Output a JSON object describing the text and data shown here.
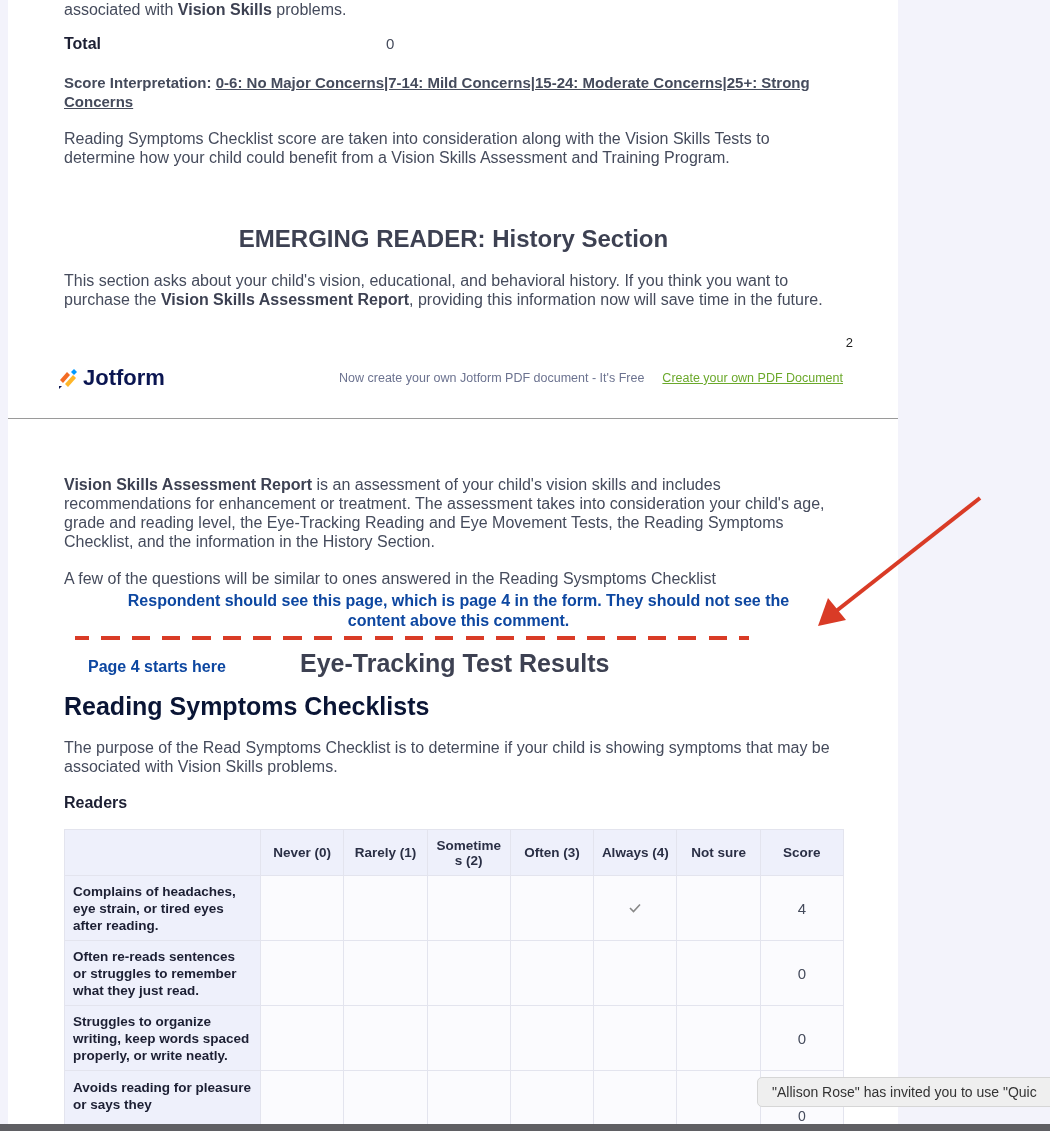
{
  "page_one": {
    "intro_tail": "associated with **Vision Skills** problems.",
    "total": {
      "label": "Total",
      "value": "0"
    },
    "score_interpretation": {
      "label": "Score Interpretation:",
      "value": "0-6: No Major Concerns|7-14: Mild Concerns|15-24: Moderate Concerns|25+:  Strong Concerns"
    },
    "note": " Reading Symptoms Checklist score are taken into consideration along with the Vision Skills Tests to determine how your child could benefit from a Vision Skills Assessment and Training Program.",
    "history": {
      "title": "EMERGING READER: History Section",
      "text": "This section asks about your child's vision, educational, and behavioral history. If you think you want to purchase the **Vision Skills Assessment Report**, providing this information now will save time in the future."
    },
    "page_number": "2"
  },
  "footer": {
    "brand": "Jotform",
    "tagline": "Now create your own Jotform PDF document - It's Free",
    "link": "Create your own PDF Document"
  },
  "page_two": {
    "report_text": "**Vision Skills Assessment Report** is an assessment of your child's vision skills and includes recommendations for enhancement or treatment.  The assessment takes into consideration your child's age, grade and reading level, the Eye-Tracking Reading and Eye Movement Tests, the Reading Symptoms Checklist, and the information in the History Section.",
    "similar_note": "A few of the questions will be similar to ones answered in the Reading Sysmptoms Checklist",
    "annotation": {
      "comment": "Respondent should see this page, which is page 4 in the form.  They should not see the content above this comment.",
      "page_marker": "Page 4 starts here"
    },
    "eye_tracking_title": "Eye-Tracking Test Results",
    "section": {
      "title": "Reading Symptoms Checklists",
      "description": "The purpose of the Read Symptoms Checklist is to determine if your child is showing symptoms that may be associated with Vision Skills problems.",
      "subheading": "Readers"
    },
    "table": {
      "columns": [
        "Never (0)",
        "Rarely (1)",
        "Sometime s (2)",
        "Often (3)",
        "Always (4)",
        "Not sure",
        "Score"
      ],
      "rows": [
        {
          "label": "Complains of headaches, eye strain, or tired eyes after reading.",
          "checks": [
            false,
            false,
            false,
            false,
            true,
            false
          ],
          "score": "4"
        },
        {
          "label": "Often re-reads sentences or struggles to remember what they just read.",
          "checks": [
            false,
            false,
            false,
            false,
            false,
            false
          ],
          "score": "0"
        },
        {
          "label": "Struggles to organize writing, keep words spaced properly, or write neatly.",
          "checks": [
            false,
            false,
            false,
            false,
            false,
            false
          ],
          "score": "0"
        },
        {
          "label": "Avoids reading for pleasure or says they",
          "checks": [
            false,
            false,
            false,
            false,
            false,
            false
          ],
          "score": "0"
        }
      ]
    }
  },
  "notification": {
    "text": "\"Allison Rose\" has invited you to use  \"Quic"
  }
}
